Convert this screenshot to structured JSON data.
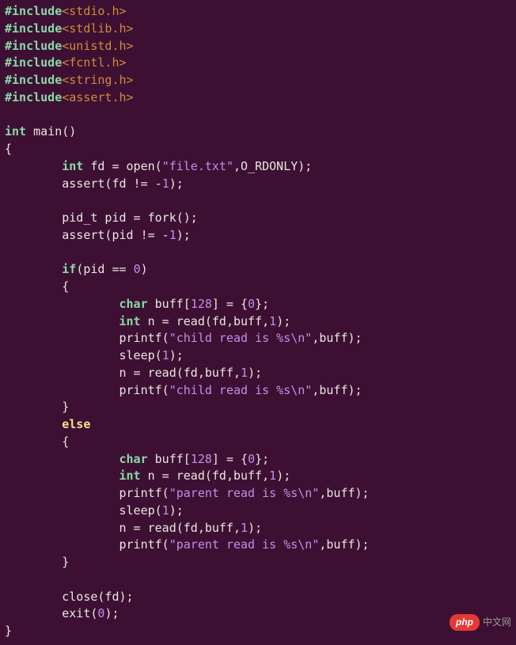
{
  "includes": [
    {
      "kw": "#include",
      "hdr": "<stdio.h>"
    },
    {
      "kw": "#include",
      "hdr": "<stdlib.h>"
    },
    {
      "kw": "#include",
      "hdr": "<unistd.h>"
    },
    {
      "kw": "#include",
      "hdr": "<fcntl.h>"
    },
    {
      "kw": "#include",
      "hdr": "<string.h>"
    },
    {
      "kw": "#include",
      "hdr": "<assert.h>"
    }
  ],
  "fn_sig": {
    "ret": "int",
    "name": "main",
    "params": "()"
  },
  "braceO": "{",
  "braceC": "}",
  "l_fd": {
    "indent": "        ",
    "type": "int",
    "rest": " fd = open(",
    "str": "\"file.txt\"",
    "rest2": ",O_RDONLY);"
  },
  "l_as1": {
    "indent": "        ",
    "txt": "assert(fd != -",
    "num": "1",
    "txt2": ");"
  },
  "l_pid": {
    "indent": "        ",
    "txt": "pid_t pid = fork();"
  },
  "l_as2": {
    "indent": "        ",
    "txt": "assert(pid != -",
    "num": "1",
    "txt2": ");"
  },
  "l_if": {
    "indent": "        ",
    "kw": "if",
    "cond": "(pid == ",
    "num": "0",
    "cond2": ")"
  },
  "l_ibo": "        {",
  "c_buf": {
    "indent": "                ",
    "type": "char",
    "rest": " buff[",
    "n1": "128",
    "rest2": "] = {",
    "n2": "0",
    "rest3": "};"
  },
  "c_rd1": {
    "indent": "                ",
    "type": "int",
    "rest": " n = read(fd,buff,",
    "num": "1",
    "rest2": ");"
  },
  "c_pr1": {
    "indent": "                ",
    "txt": "printf(",
    "str": "\"child read is %s\\n\"",
    "txt2": ",buff);"
  },
  "c_slp": {
    "indent": "                ",
    "txt": "sleep(",
    "num": "1",
    "txt2": ");"
  },
  "c_rd2": {
    "indent": "                ",
    "txt": "n = read(fd,buff,",
    "num": "1",
    "txt2": ");"
  },
  "c_pr2": {
    "indent": "                ",
    "txt": "printf(",
    "str": "\"child read is %s\\n\"",
    "txt2": ",buff);"
  },
  "l_ibc": "        }",
  "l_else": {
    "indent": "        ",
    "kw": "else"
  },
  "l_ebo": "        {",
  "p_buf": {
    "indent": "                ",
    "type": "char",
    "rest": " buff[",
    "n1": "128",
    "rest2": "] = {",
    "n2": "0",
    "rest3": "};"
  },
  "p_rd1": {
    "indent": "                ",
    "type": "int",
    "rest": " n = read(fd,buff,",
    "num": "1",
    "rest2": ");"
  },
  "p_pr1": {
    "indent": "                ",
    "txt": "printf(",
    "str": "\"parent read is %s\\n\"",
    "txt2": ",buff);"
  },
  "p_slp": {
    "indent": "                ",
    "txt": "sleep(",
    "num": "1",
    "txt2": ");"
  },
  "p_rd2": {
    "indent": "                ",
    "txt": "n = read(fd,buff,",
    "num": "1",
    "txt2": ");"
  },
  "p_pr2": {
    "indent": "                ",
    "txt": "printf(",
    "str": "\"parent read is %s\\n\"",
    "txt2": ",buff);"
  },
  "l_ebc": "        }",
  "l_cls": {
    "indent": "        ",
    "txt": "close(fd);"
  },
  "l_ext": {
    "indent": "        ",
    "txt": "exit(",
    "num": "0",
    "txt2": ");"
  },
  "watermark": {
    "pill": "php",
    "txt": "中文网"
  }
}
